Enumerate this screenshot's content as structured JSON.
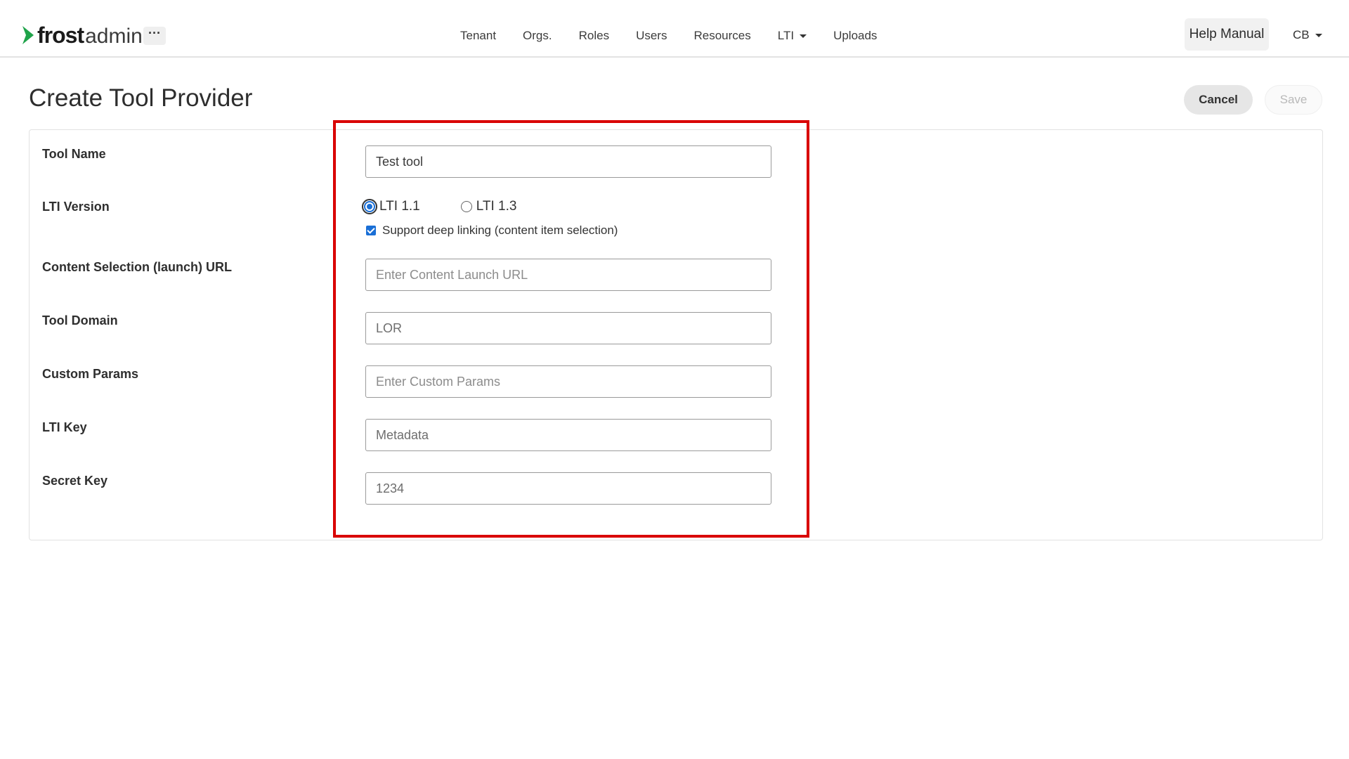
{
  "app": {
    "logo_bold": "frost",
    "logo_light": "admin",
    "more_label": "···"
  },
  "nav": {
    "items": [
      "Tenant",
      "Orgs.",
      "Roles",
      "Users",
      "Resources",
      "LTI",
      "Uploads"
    ],
    "help_label": "Help Manual",
    "user_initials": "CB"
  },
  "page": {
    "title": "Create Tool Provider",
    "cancel_label": "Cancel",
    "save_label": "Save"
  },
  "form": {
    "tool_name": {
      "label": "Tool Name",
      "value": "Test tool"
    },
    "lti_version": {
      "label": "LTI Version",
      "options": [
        "LTI 1.1",
        "LTI 1.3"
      ],
      "selected": "LTI 1.1"
    },
    "deep_linking": {
      "label": "Support deep linking (content item selection)",
      "checked": true
    },
    "launch_url": {
      "label": "Content Selection (launch) URL",
      "placeholder": "Enter Content Launch URL"
    },
    "tool_domain": {
      "label": "Tool Domain",
      "value": "LOR"
    },
    "custom_params": {
      "label": "Custom Params",
      "placeholder": "Enter Custom Params"
    },
    "lti_key": {
      "label": "LTI Key",
      "value": "Metadata"
    },
    "secret_key": {
      "label": "Secret Key",
      "value": "1234"
    }
  },
  "colors": {
    "highlight": "#d90000",
    "accent": "#1a6fd6",
    "logo_green": "#1fa34a"
  }
}
